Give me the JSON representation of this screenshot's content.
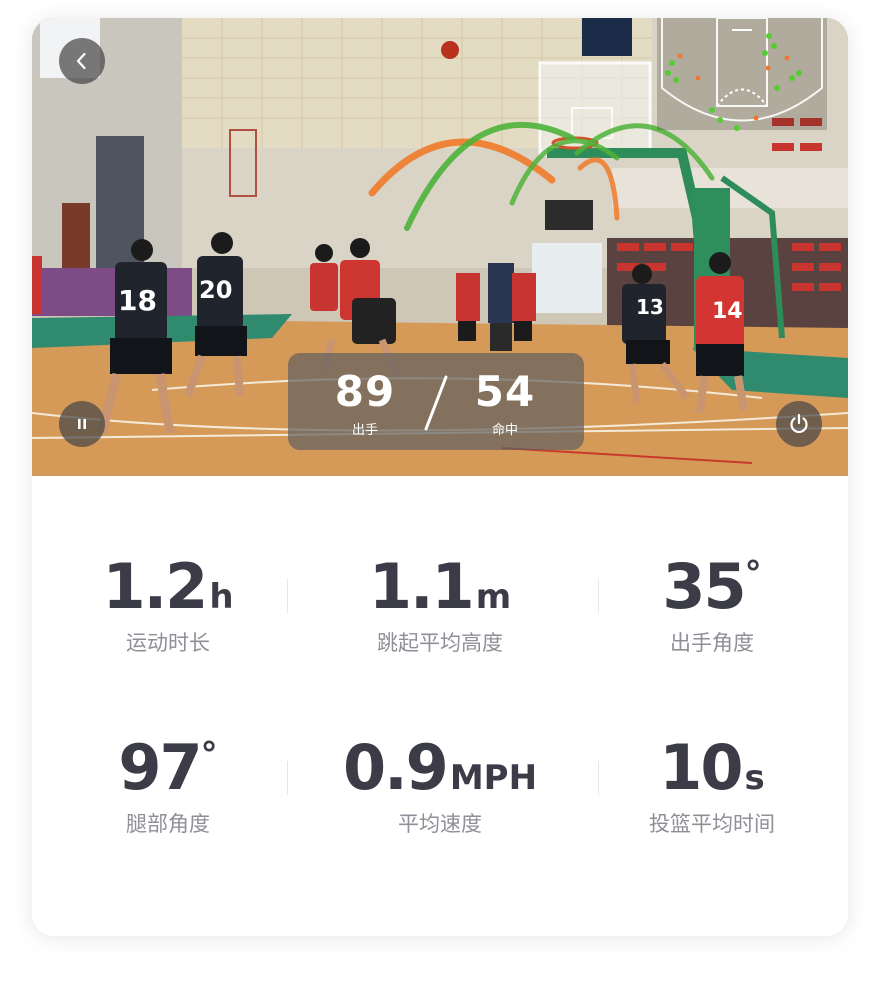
{
  "video": {
    "score": {
      "attempts": "89",
      "attempts_label": "出手",
      "made": "54",
      "made_label": "命中"
    },
    "jersey_numbers": [
      "18",
      "20",
      "13",
      "14"
    ],
    "court_map": {
      "made_color": "#55cc33",
      "missed_color": "#ee7733"
    },
    "trajectory_colors": {
      "made": "#4db33a",
      "missed": "#f07a2a"
    },
    "icons": {
      "back": "chevron-left-icon",
      "pause": "pause-icon",
      "power": "power-icon"
    }
  },
  "stats": [
    {
      "value": "1.2",
      "unit": "h",
      "label": "运动时长"
    },
    {
      "value": "1.1",
      "unit": "m",
      "label": "跳起平均高度"
    },
    {
      "value": "35",
      "unit": "°",
      "label": "出手角度"
    },
    {
      "value": "97",
      "unit": "°",
      "label": "腿部角度"
    },
    {
      "value": "0.9",
      "unit": "MPH",
      "label": "平均速度"
    },
    {
      "value": "10",
      "unit": "s",
      "label": "投篮平均时间"
    }
  ],
  "colors": {
    "stat_value": "#3c3c48",
    "stat_label": "#8f8f97"
  }
}
